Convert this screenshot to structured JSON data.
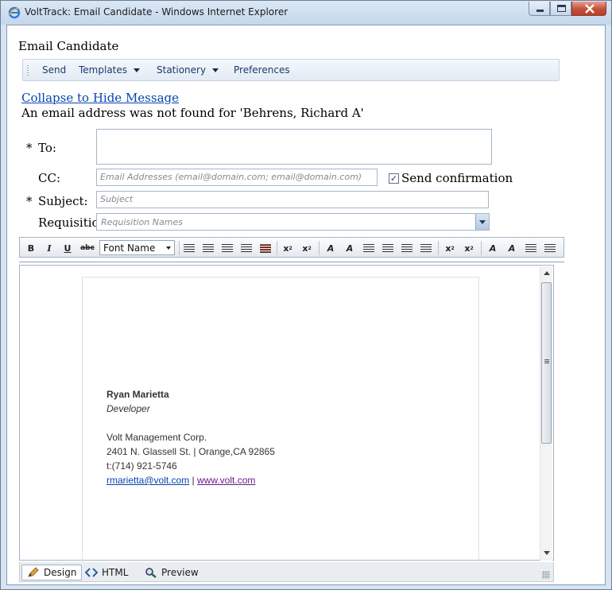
{
  "window": {
    "title": "VoltTrack: Email Candidate - Windows Internet Explorer"
  },
  "page": {
    "title": "Email Candidate",
    "collapse_link": "Collapse to Hide Message",
    "message": "An email address was not found for 'Behrens, Richard A'"
  },
  "toolbar": {
    "send": "Send",
    "templates": "Templates",
    "stationery": "Stationery",
    "preferences": "Preferences"
  },
  "form": {
    "required_marker": "*",
    "to_label": "To:",
    "cc_label": "CC:",
    "cc_placeholder": "Email Addresses (email@domain.com; email@domain.com)",
    "send_confirmation_label": "Send confirmation",
    "send_confirmation_checked": true,
    "subject_label": "Subject:",
    "subject_placeholder": "Subject",
    "requisition_label": "Requisition:",
    "requisition_placeholder": "Requisition Names"
  },
  "editor_toolbar": {
    "bold": "B",
    "italic": "I",
    "underline": "U",
    "strike": "abc",
    "font_name": "Font Name"
  },
  "signature": {
    "name": "Ryan Marietta",
    "role": "Developer",
    "company": "Volt Management Corp.",
    "address": "2401 N. Glassell St. | Orange,CA 92865",
    "phone": "t:(714) 921-5746",
    "email": "rmarietta@volt.com",
    "separator": "|",
    "website": "www.volt.com"
  },
  "modes": {
    "design": "Design",
    "html": "HTML",
    "preview": "Preview"
  },
  "colors": {
    "link": "#0645ad",
    "visited_link": "#6b1a8c",
    "accent": "#1d3a78"
  }
}
